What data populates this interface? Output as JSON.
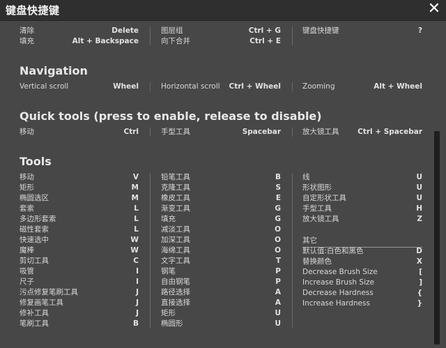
{
  "window": {
    "title": "键盘快捷键",
    "close_symbol": "✕"
  },
  "top_group": {
    "col1": [
      {
        "label": "清除",
        "key": "Delete"
      },
      {
        "label": "填充",
        "key": "Alt + Backspace"
      }
    ],
    "col2": [
      {
        "label": "图层组",
        "key": "Ctrl + G"
      },
      {
        "label": "向下合并",
        "key": "Ctrl + E"
      }
    ],
    "col3": [
      {
        "label": "键盘快捷键",
        "key": "?"
      }
    ]
  },
  "navigation": {
    "title": "Navigation",
    "items": [
      {
        "label": "Vertical scroll",
        "key": "Wheel"
      },
      {
        "label": "Horizontal scroll",
        "key": "Ctrl + Wheel"
      },
      {
        "label": "Zooming",
        "key": "Alt + Wheel"
      }
    ]
  },
  "quick_tools": {
    "title": "Quick tools (press to enable, release to disable)",
    "items": [
      {
        "label": "移动",
        "key": "Ctrl"
      },
      {
        "label": "手型工具",
        "key": "Spacebar"
      },
      {
        "label": "放大镜工具",
        "key": "Ctrl + Spacebar"
      }
    ]
  },
  "tools": {
    "title": "Tools",
    "col1": [
      {
        "label": "移动",
        "key": "V"
      },
      {
        "label": "矩形",
        "key": "M"
      },
      {
        "label": "椭圆选区",
        "key": "M"
      },
      {
        "label": "套索",
        "key": "L"
      },
      {
        "label": "多边形套索",
        "key": "L"
      },
      {
        "label": "磁性套索",
        "key": "L"
      },
      {
        "label": "快速选中",
        "key": "W"
      },
      {
        "label": "魔棒",
        "key": "W"
      },
      {
        "label": "剪切工具",
        "key": "C"
      },
      {
        "label": "吸管",
        "key": "I"
      },
      {
        "label": "尺子",
        "key": "I"
      },
      {
        "label": "污点修复笔刷工具",
        "key": "J"
      },
      {
        "label": "修复画笔工具",
        "key": "J"
      },
      {
        "label": "修补工具",
        "key": "J"
      },
      {
        "label": "笔刷工具",
        "key": "B"
      }
    ],
    "col2": [
      {
        "label": "铅笔工具",
        "key": "B"
      },
      {
        "label": "克隆工具",
        "key": "S"
      },
      {
        "label": "橡皮工具",
        "key": "E"
      },
      {
        "label": "渐变工具",
        "key": "G"
      },
      {
        "label": "填充",
        "key": "G"
      },
      {
        "label": "减淡工具",
        "key": "O"
      },
      {
        "label": "加深工具",
        "key": "O"
      },
      {
        "label": "海绵工具",
        "key": "O"
      },
      {
        "label": "文字工具",
        "key": "T"
      },
      {
        "label": "钢笔",
        "key": "P"
      },
      {
        "label": "自由钢笔",
        "key": "P"
      },
      {
        "label": "路径选择",
        "key": "A"
      },
      {
        "label": "直接选择",
        "key": "A"
      },
      {
        "label": "矩形",
        "key": "U"
      },
      {
        "label": "椭圆形",
        "key": "U"
      }
    ],
    "col3": [
      {
        "label": "线",
        "key": "U"
      },
      {
        "label": "形状图形",
        "key": "U"
      },
      {
        "label": "自定形状工具",
        "key": "U"
      },
      {
        "label": "手型工具",
        "key": "H"
      },
      {
        "label": "放大镜工具",
        "key": "Z"
      }
    ],
    "other_title": "其它",
    "other": [
      {
        "label": "默认值:白色和黑色",
        "key": "D"
      },
      {
        "label": "替换颜色",
        "key": "X"
      },
      {
        "label": "Decrease Brush Size",
        "key": "["
      },
      {
        "label": "Increase Brush Size",
        "key": "]"
      },
      {
        "label": "Decrease Hardness",
        "key": "{"
      },
      {
        "label": "Increase Hardness",
        "key": "}"
      }
    ]
  }
}
